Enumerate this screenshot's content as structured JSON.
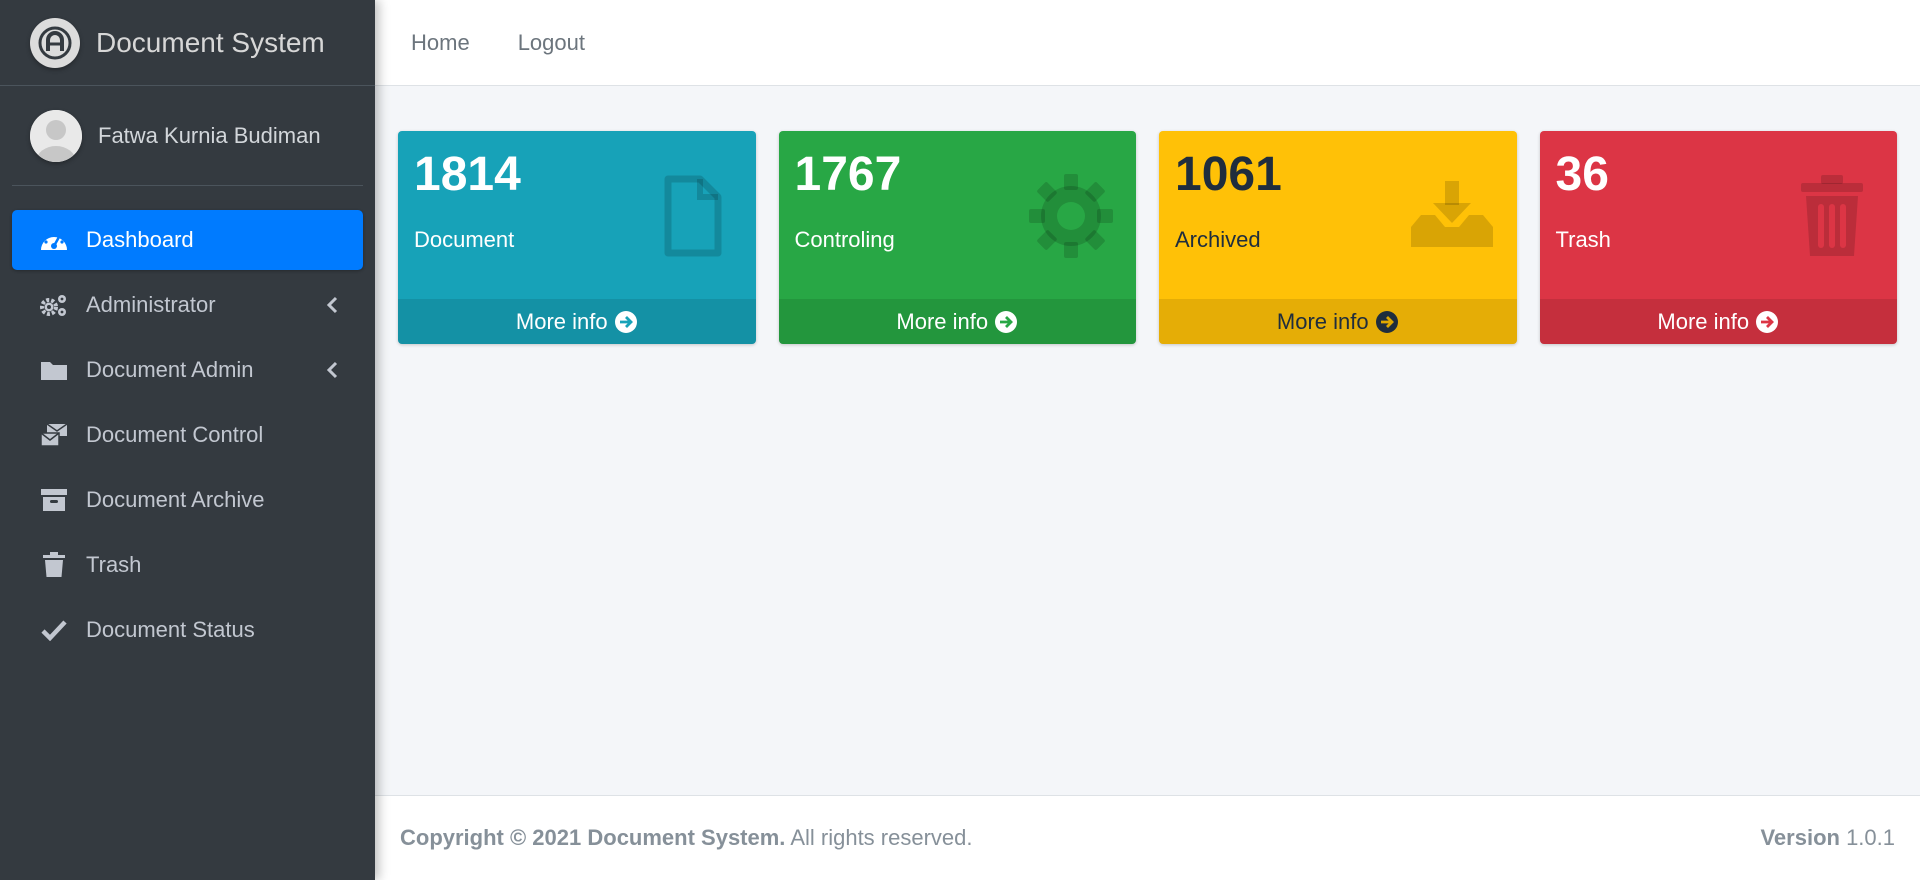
{
  "brand": {
    "name": "Document System",
    "logo_icon": "app-logo-icon"
  },
  "user": {
    "name": "Fatwa Kurnia Budiman",
    "avatar_icon": "user-avatar-icon"
  },
  "sidebar": {
    "items": [
      {
        "label": "Dashboard",
        "icon": "dashboard-icon",
        "active": true
      },
      {
        "label": "Administrator",
        "icon": "cogs-icon",
        "has_submenu": true
      },
      {
        "label": "Document Admin",
        "icon": "folder-icon",
        "has_submenu": true
      },
      {
        "label": "Document Control",
        "icon": "mail-bulk-icon"
      },
      {
        "label": "Document Archive",
        "icon": "archive-icon"
      },
      {
        "label": "Trash",
        "icon": "trash-icon"
      },
      {
        "label": "Document Status",
        "icon": "check-icon"
      }
    ]
  },
  "header": {
    "links": [
      {
        "label": "Home"
      },
      {
        "label": "Logout"
      }
    ]
  },
  "cards": [
    {
      "count": "1814",
      "label": "Document",
      "more": "More info",
      "icon": "file-icon",
      "color": "#17a2b8"
    },
    {
      "count": "1767",
      "label": "Controling",
      "more": "More info",
      "icon": "gear-icon",
      "color": "#28a745"
    },
    {
      "count": "1061",
      "label": "Archived",
      "more": "More info",
      "icon": "download-tray-icon",
      "color": "#ffc107"
    },
    {
      "count": "36",
      "label": "Trash",
      "more": "More info",
      "icon": "trash-icon",
      "color": "#dc3545"
    }
  ],
  "footer": {
    "copyright_bold": "Copyright © 2021 Document System.",
    "copyright_rest": " All rights reserved.",
    "version_label": "Version",
    "version_value": " 1.0.1"
  },
  "colors": {
    "sidebar": "#343a40",
    "active": "#007bff",
    "background": "#f4f6f9"
  }
}
